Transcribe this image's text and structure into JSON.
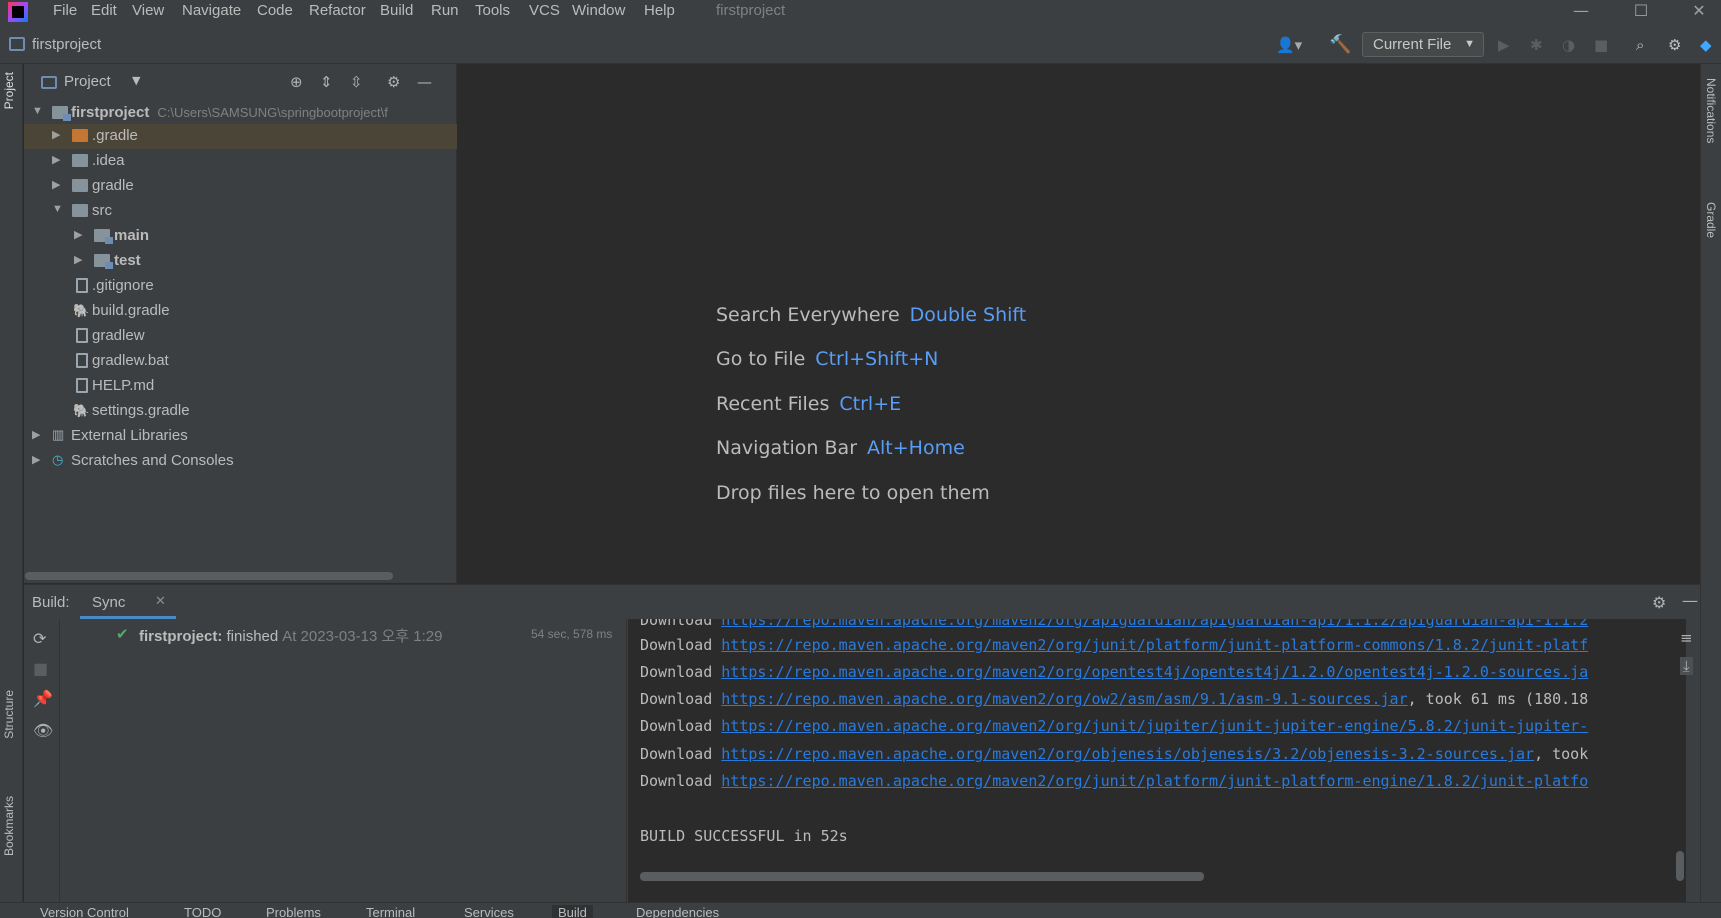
{
  "menu": [
    "File",
    "Edit",
    "View",
    "Navigate",
    "Code",
    "Refactor",
    "Build",
    "Run",
    "Tools",
    "VCS",
    "Window",
    "Help"
  ],
  "window_title": "firstproject",
  "window_controls": {
    "minimize": "—",
    "maximize": "☐",
    "close": "✕"
  },
  "navbar": {
    "project_name": "firstproject",
    "run_config": "Current File"
  },
  "left_strip": {
    "project": "Project",
    "structure": "Structure",
    "bookmarks": "Bookmarks"
  },
  "right_strip": {
    "notifications": "Notifications",
    "gradle": "Gradle"
  },
  "project_panel": {
    "title": "Project",
    "tree": [
      {
        "label": "firstproject",
        "path": "C:\\Users\\SAMSUNG\\springbootproject\\f",
        "bold": true
      },
      {
        "label": ".gradle"
      },
      {
        "label": ".idea"
      },
      {
        "label": "gradle"
      },
      {
        "label": "src"
      },
      {
        "label": "main"
      },
      {
        "label": "test"
      },
      {
        "label": ".gitignore"
      },
      {
        "label": "build.gradle"
      },
      {
        "label": "gradlew"
      },
      {
        "label": "gradlew.bat"
      },
      {
        "label": "HELP.md"
      },
      {
        "label": "settings.gradle"
      },
      {
        "label": "External Libraries"
      },
      {
        "label": "Scratches and Consoles"
      }
    ]
  },
  "editor_hints": [
    {
      "action": "Search Everywhere",
      "key": "Double Shift"
    },
    {
      "action": "Go to File",
      "key": "Ctrl+Shift+N"
    },
    {
      "action": "Recent Files",
      "key": "Ctrl+E"
    },
    {
      "action": "Navigation Bar",
      "key": "Alt+Home"
    },
    {
      "action": "Drop files here to open them",
      "key": ""
    }
  ],
  "build_panel": {
    "label": "Build:",
    "tab": "Sync",
    "result": {
      "name": "firstproject:",
      "status": "finished",
      "time": "At 2023-03-13 오후 1:29",
      "duration": "54 sec, 578 ms"
    },
    "console": [
      {
        "prefix": "Download ",
        "link": "https://repo.maven.apache.org/maven2/org/apiguardian/apiguardian-api/1.1.2/apiguardian-api-1.1.2",
        "suffix": ""
      },
      {
        "prefix": "Download ",
        "link": "https://repo.maven.apache.org/maven2/org/junit/platform/junit-platform-commons/1.8.2/junit-platf",
        "suffix": ""
      },
      {
        "prefix": "Download ",
        "link": "https://repo.maven.apache.org/maven2/org/opentest4j/opentest4j/1.2.0/opentest4j-1.2.0-sources.ja",
        "suffix": ""
      },
      {
        "prefix": "Download ",
        "link": "https://repo.maven.apache.org/maven2/org/ow2/asm/asm/9.1/asm-9.1-sources.jar",
        "suffix": ", took 61 ms (180.18"
      },
      {
        "prefix": "Download ",
        "link": "https://repo.maven.apache.org/maven2/org/junit/jupiter/junit-jupiter-engine/5.8.2/junit-jupiter-",
        "suffix": ""
      },
      {
        "prefix": "Download ",
        "link": "https://repo.maven.apache.org/maven2/org/objenesis/objenesis/3.2/objenesis-3.2-sources.jar",
        "suffix": ", took"
      },
      {
        "prefix": "Download ",
        "link": "https://repo.maven.apache.org/maven2/org/junit/platform/junit-platform-engine/1.8.2/junit-platfo",
        "suffix": ""
      }
    ],
    "summary": "BUILD SUCCESSFUL in 52s"
  },
  "bottom_tabs": [
    "Version Control",
    "TODO",
    "Problems",
    "Terminal",
    "Services",
    "Build",
    "Dependencies"
  ],
  "colors": {
    "accent": "#4a88c7",
    "link": "#287bde",
    "key": "#589df6",
    "success": "#59a869"
  }
}
